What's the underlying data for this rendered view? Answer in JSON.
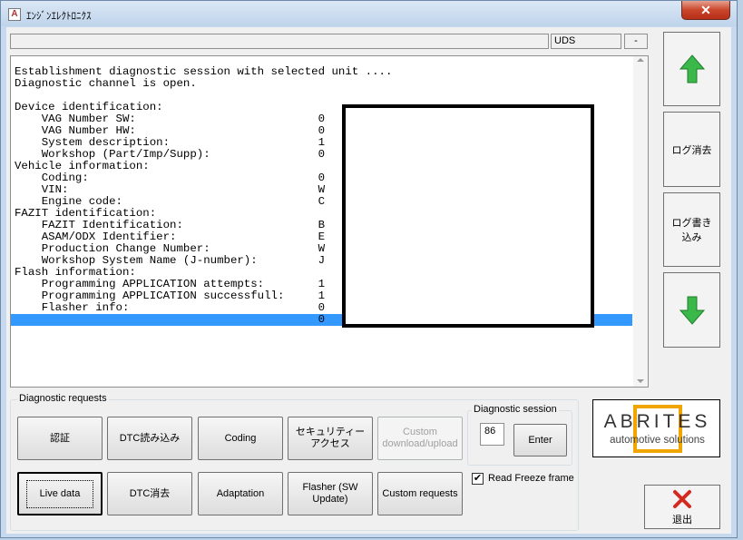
{
  "window": {
    "title": "ｴﾝｼﾞﾝｴﾚｸﾄﾛﾆｸｽ",
    "app_icon_letter": "A",
    "close_glyph": "✕"
  },
  "status_bar": {
    "main_text": "",
    "protocol": "UDS",
    "indicator": "-"
  },
  "log": {
    "lines": [
      "Establishment diagnostic session with selected unit ....",
      "Diagnostic channel is open.",
      "",
      "Device identification:",
      "    VAG Number SW:                           0",
      "    VAG Number HW:                           0",
      "    System description:                      1",
      "    Workshop (Part/Imp/Supp):                0",
      "Vehicle information:",
      "    Coding:                                  0",
      "    VIN:                                     W",
      "    Engine code:                             C",
      "FAZIT identification:",
      "    FAZIT Identification:                    B",
      "    ASAM/ODX Identifier:                     E",
      "    Production Change Number:                W",
      "    Workshop System Name (J-number):         J",
      "Flash information:",
      "    Programming APPLICATION attempts:        1",
      "    Programming APPLICATION successfull:     1",
      "    Flasher info:                            0",
      "                                             0"
    ]
  },
  "side_buttons": {
    "up_icon": "up-arrow-icon",
    "clear_log": "ログ消去",
    "write_log": "ログ書き込み",
    "down_icon": "down-arrow-icon"
  },
  "diagnostic_requests": {
    "legend": "Diagnostic requests",
    "row1": [
      "認証",
      "DTC読み込み",
      "Coding",
      "セキュリティーアクセス",
      "Custom download/upload"
    ],
    "row2": [
      "Live data",
      "DTC消去",
      "Adaptation",
      "Flasher (SW Update)",
      "Custom requests"
    ]
  },
  "diagnostic_session": {
    "legend": "Diagnostic session",
    "value": "86",
    "enter_label": "Enter"
  },
  "read_freeze": {
    "label": "Read Freeze frame",
    "checked": true,
    "check_glyph": "✔"
  },
  "logo": {
    "word": "ABRITES",
    "subtitle": "automotive solutions"
  },
  "exit": {
    "label": "退出"
  },
  "colors": {
    "selection": "#3399ff",
    "green_arrow": "#3bb84a",
    "exit_red": "#d22a1e",
    "logo_orange": "#f0a500"
  }
}
